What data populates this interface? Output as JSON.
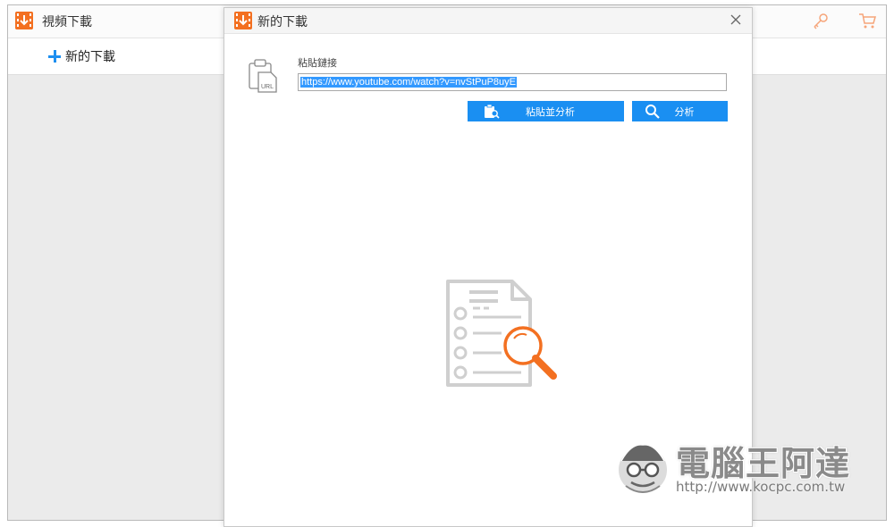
{
  "app": {
    "title": "視頻下載",
    "new_download_label": "新的下載",
    "icons": [
      "download-logo-icon",
      "key-icon",
      "cart-icon"
    ],
    "accent_color": "#f37021"
  },
  "dialog": {
    "title": "新的下載",
    "url_label": "粘貼鏈接",
    "url_value": "https://www.youtube.com/watch?v=nvStPuP8uyE",
    "url_icon_text": "URL",
    "paste_analyze_label": "粘貼並分析",
    "analyze_label": "分析",
    "button_color": "#1a8ff2"
  },
  "watermark": {
    "brand": "電腦王阿達",
    "url": "http://www.kocpc.com.tw"
  }
}
